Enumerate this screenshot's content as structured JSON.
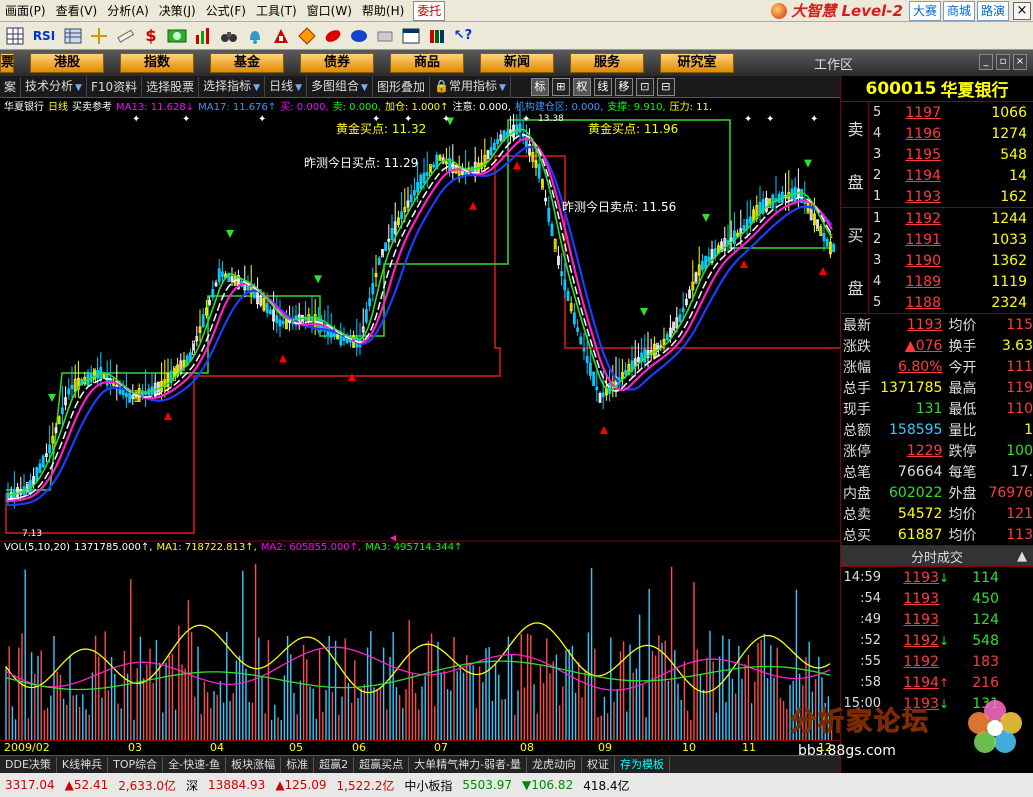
{
  "menu": {
    "items": [
      "画面(P)",
      "查看(V)",
      "分析(A)",
      "决策(J)",
      "公式(F)",
      "工具(T)",
      "窗口(W)",
      "帮助(H)"
    ],
    "weituo": "委托",
    "logo": "大智慧 Level-2",
    "right_buttons": [
      "大赛",
      "商城",
      "路演"
    ],
    "close": "×"
  },
  "toolbar": {
    "icons": [
      "grid-icon",
      "rsi-icon",
      "table-icon",
      "crosshair-icon",
      "ruler-icon",
      "dollar-icon",
      "trade-icon",
      "bar-chart-icon",
      "binoculars-icon",
      "alert-bell-icon",
      "fund-icon",
      "diamond-icon",
      "pill-icon",
      "quote-icon",
      "eraser-icon",
      "window-icon",
      "books-icon",
      "help-cursor-icon"
    ],
    "rsi_label": "RSI",
    "dollar_label": "$"
  },
  "categories": [
    "港股",
    "指数",
    "基金",
    "债券",
    "商品",
    "新闻",
    "服务",
    "研究室"
  ],
  "category_stub": "票",
  "workspace": "工作区",
  "subtoolbar": {
    "items": [
      "案",
      "技术分析",
      "F10资料",
      "选择股票",
      "选择指标",
      "日线",
      "多图组合",
      "图形叠加",
      "常用指标"
    ],
    "toggles": [
      "标",
      "⊞",
      "权",
      "线",
      "移",
      "⊡",
      "⊟"
    ]
  },
  "chart": {
    "legend_main": [
      {
        "text": "华夏银行",
        "color": "w"
      },
      {
        "text": "日线",
        "color": "y"
      },
      {
        "text": "买卖参考",
        "color": "w"
      },
      {
        "text": "MA13: 11.628↓",
        "color": "m"
      },
      {
        "text": "MA17: 11.676↑",
        "color": "b"
      },
      {
        "text": "买: 0.000,",
        "color": "m"
      },
      {
        "text": "卖: 0.000,",
        "color": "g"
      },
      {
        "text": "加仓: 1.000↑",
        "color": "y"
      },
      {
        "text": "注意: 0.000,",
        "color": "w"
      },
      {
        "text": "机构建仓区: 0.000,",
        "color": "b"
      },
      {
        "text": "支撑: 9.910,",
        "color": "g"
      },
      {
        "text": "压力: 11.",
        "color": "y"
      }
    ],
    "legend_vol": [
      {
        "text": "VOL(5,10,20)",
        "color": "w"
      },
      {
        "text": "1371785.000↑,",
        "color": "w"
      },
      {
        "text": "MA1: 718722.813↑,",
        "color": "y"
      },
      {
        "text": "MA2: 605855.000↑,",
        "color": "m"
      },
      {
        "text": "MA3: 495714.344↑",
        "color": "g"
      }
    ],
    "annotations": {
      "gold_buy_1": "黄金买点: 11.32",
      "gold_buy_2": "黄金买点: 11.96",
      "yesterday_buy": "昨测今日买点: 11.29",
      "yesterday_sell": "昨测今日卖点: 11.56",
      "high_label": "13.38",
      "low_label": "7.13"
    },
    "date_labels": [
      "2009/02",
      "03",
      "04",
      "05",
      "06",
      "07",
      "08",
      "09",
      "10",
      "11",
      "12"
    ]
  },
  "tabs": [
    "DDE决策",
    "K线神兵",
    "TOP综合",
    "全-快速-鱼",
    "板块涨幅",
    "标准",
    "超赢2",
    "超赢买点",
    "大单精气神力-弱者-量",
    "龙虎动向",
    "权证",
    "存为模板"
  ],
  "status": {
    "items": [
      {
        "text": "3317.04",
        "cls": "red"
      },
      {
        "text": "▲52.41",
        "cls": "red"
      },
      {
        "text": "2,633.0亿",
        "cls": "red"
      },
      {
        "text": "深",
        "cls": ""
      },
      {
        "text": "13884.93",
        "cls": "red"
      },
      {
        "text": "▲125.09",
        "cls": "red"
      },
      {
        "text": "1,522.2亿",
        "cls": "red"
      },
      {
        "text": "中小板指",
        "cls": ""
      },
      {
        "text": "5503.97",
        "cls": "grn"
      },
      {
        "text": "▼106.82",
        "cls": "grn"
      },
      {
        "text": "418.4亿",
        "cls": ""
      }
    ]
  },
  "stock": {
    "code": "600015",
    "name": "华夏银行",
    "sell_label": [
      "卖",
      "盘"
    ],
    "buy_label": [
      "买",
      "盘"
    ],
    "sell": [
      {
        "lv": "5",
        "price": "1197",
        "vol": "1066"
      },
      {
        "lv": "4",
        "price": "1196",
        "vol": "1274"
      },
      {
        "lv": "3",
        "price": "1195",
        "vol": "548"
      },
      {
        "lv": "2",
        "price": "1194",
        "vol": "14"
      },
      {
        "lv": "1",
        "price": "1193",
        "vol": "162"
      }
    ],
    "buy": [
      {
        "lv": "1",
        "price": "1192",
        "vol": "1244"
      },
      {
        "lv": "2",
        "price": "1191",
        "vol": "1033"
      },
      {
        "lv": "3",
        "price": "1190",
        "vol": "1362"
      },
      {
        "lv": "4",
        "price": "1189",
        "vol": "1119"
      },
      {
        "lv": "5",
        "price": "1188",
        "vol": "2324"
      }
    ],
    "stats": [
      {
        "k1": "最新",
        "v1": "1193",
        "c1": "c-red u",
        "k2": "均价",
        "v2": "115",
        "c2": "c-red"
      },
      {
        "k1": "涨跌",
        "v1": "▲076",
        "c1": "c-red u",
        "k2": "换手",
        "v2": "3.63",
        "c2": "c-yel"
      },
      {
        "k1": "涨幅",
        "v1": "6.80%",
        "c1": "c-red u",
        "k2": "今开",
        "v2": "111",
        "c2": "c-red"
      },
      {
        "k1": "总手",
        "v1": "1371785",
        "c1": "c-yel",
        "k2": "最高",
        "v2": "119",
        "c2": "c-red"
      },
      {
        "k1": "现手",
        "v1": "131",
        "c1": "c-grn",
        "k2": "最低",
        "v2": "110",
        "c2": "c-red"
      },
      {
        "k1": "总额",
        "v1": "158595",
        "c1": "c-cyan",
        "k2": "量比",
        "v2": "1",
        "c2": "c-yel"
      },
      {
        "k1": "涨停",
        "v1": "1229",
        "c1": "c-red u",
        "k2": "跌停",
        "v2": "100",
        "c2": "c-grn"
      },
      {
        "k1": "总笔",
        "v1": "76664",
        "c1": "c-wht",
        "k2": "每笔",
        "v2": "17.",
        "c2": "c-wht"
      },
      {
        "k1": "内盘",
        "v1": "602022",
        "c1": "c-grn",
        "k2": "外盘",
        "v2": "76976",
        "c2": "c-red"
      },
      {
        "k1": "总卖",
        "v1": "54572",
        "c1": "c-yel",
        "k2": "均价",
        "v2": "121",
        "c2": "c-red"
      },
      {
        "k1": "总买",
        "v1": "61887",
        "c1": "c-yel",
        "k2": "均价",
        "v2": "113",
        "c2": "c-red"
      }
    ],
    "tick_title": "分时成交",
    "ticks": [
      {
        "t": "14:59",
        "p": "1193",
        "ar": "↓",
        "arc": "c-grn",
        "v": "114",
        "vc": "c-grn",
        "d": ""
      },
      {
        "t": ":54",
        "p": "1193",
        "ar": "",
        "arc": "",
        "v": "450",
        "vc": "c-grn",
        "d": ""
      },
      {
        "t": ":49",
        "p": "1193",
        "ar": "",
        "arc": "",
        "v": "124",
        "vc": "c-grn",
        "d": ""
      },
      {
        "t": ":52",
        "p": "1192",
        "ar": "↓",
        "arc": "c-grn",
        "v": "548",
        "vc": "c-grn",
        "d": ""
      },
      {
        "t": ":55",
        "p": "1192",
        "ar": "",
        "arc": "",
        "v": "183",
        "vc": "c-red",
        "d": ""
      },
      {
        "t": ":58",
        "p": "1194",
        "ar": "↑",
        "arc": "c-red",
        "v": "216",
        "vc": "c-red",
        "d": ""
      },
      {
        "t": "15:00",
        "p": "1193",
        "ar": "↓",
        "arc": "c-grn",
        "v": "131",
        "vc": "c-grn",
        "d": ""
      }
    ]
  },
  "watermark": {
    "title": "分析家论坛",
    "url": "bbs.88gs.com"
  }
}
